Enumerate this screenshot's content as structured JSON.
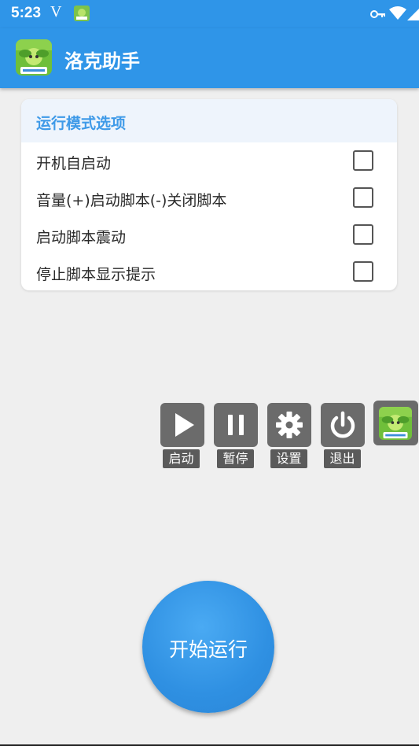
{
  "status_bar": {
    "time": "5:23",
    "carrier_glyph": "V",
    "icons": [
      "app-notification-icon",
      "vpn-key-icon",
      "wifi-icon",
      "signal-icon",
      "battery-charging-icon"
    ]
  },
  "app_bar": {
    "title": "洛克助手",
    "logo_icon": "roco-assistant-logo-icon",
    "color": "#2f95e8"
  },
  "options_card": {
    "header": "运行模式选项",
    "header_color": "#3f9ae8",
    "options": [
      {
        "label": "开机自启动",
        "checked": false
      },
      {
        "label": "音量(+)启动脚本(-)关闭脚本",
        "checked": false
      },
      {
        "label": "启动脚本震动",
        "checked": false
      },
      {
        "label": "停止脚本显示提示",
        "checked": false
      }
    ]
  },
  "floating_panel": {
    "buttons": [
      {
        "icon": "play-icon",
        "label": "启动"
      },
      {
        "icon": "pause-icon",
        "label": "暂停"
      },
      {
        "icon": "gear-icon",
        "label": "设置"
      },
      {
        "icon": "power-icon",
        "label": "退出"
      }
    ],
    "logo_icon": "roco-assistant-logo-icon"
  },
  "start_button": {
    "label": "开始运行",
    "color": "#2f90e2"
  }
}
